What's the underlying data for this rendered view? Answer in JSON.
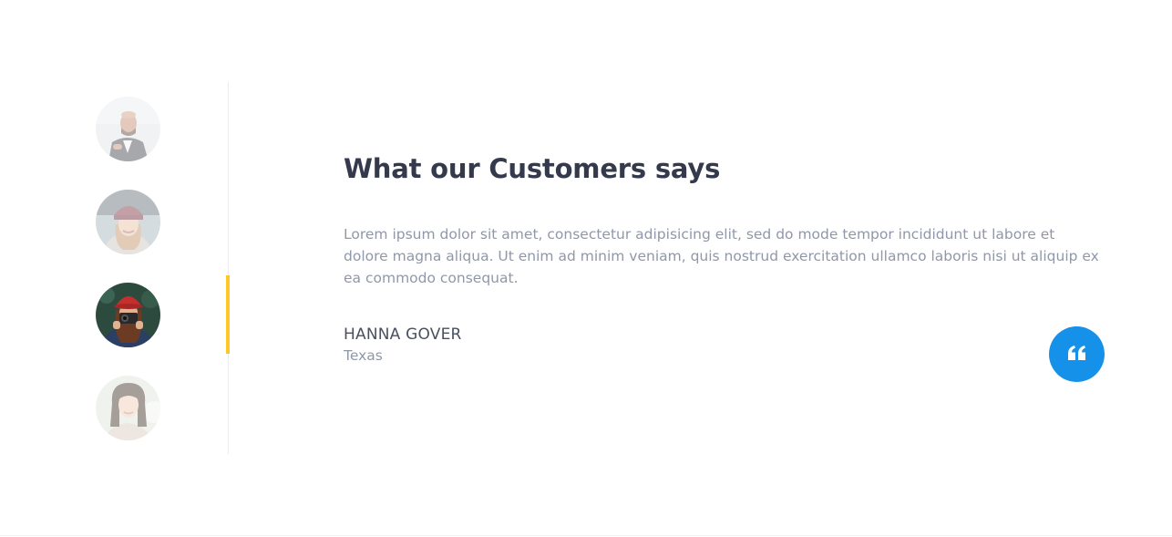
{
  "colors": {
    "heading": "#343a4c",
    "body_text": "#9097a8",
    "accent_yellow": "#ffc727",
    "accent_blue": "#1591ea",
    "divider": "#ececf0"
  },
  "customers": [
    {
      "avatar": "avatar-bald-man-suit",
      "active": false
    },
    {
      "avatar": "avatar-woman-beanie",
      "active": false
    },
    {
      "avatar": "avatar-woman-red-hat-camera",
      "active": true
    },
    {
      "avatar": "avatar-asian-woman",
      "active": false
    }
  ],
  "testimonial": {
    "heading": "What our Customers says",
    "text": "Lorem ipsum dolor sit amet, consectetur adipisicing elit, sed do mode tempor incididunt ut labore et dolore magna aliqua. Ut enim ad minim veniam, quis nostrud exercitation ullamco laboris nisi ut aliquip ex ea commodo consequat.",
    "author_name": "HANNA GOVER",
    "author_location": "Texas",
    "badge_icon": "quote-icon"
  }
}
